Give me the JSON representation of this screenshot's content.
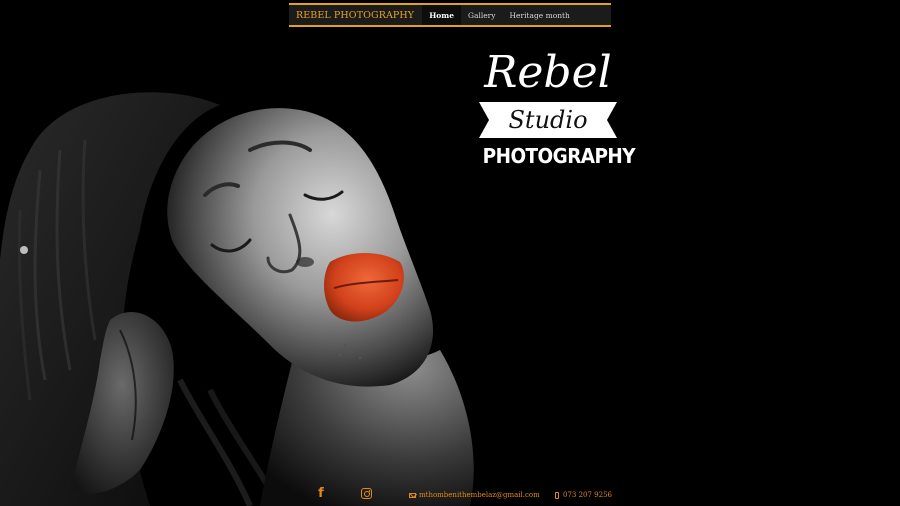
{
  "nav": {
    "brand": "REBEL PHOTOGRAPHY",
    "items": [
      {
        "label": "Home",
        "active": true
      },
      {
        "label": "Gallery",
        "active": false
      },
      {
        "label": "Heritage month",
        "active": false
      }
    ]
  },
  "logo": {
    "line1": "Rebel",
    "line2": "Studio",
    "line3": "PHOTOGRAPHY"
  },
  "footer": {
    "facebook_icon": "facebook-icon",
    "instagram_icon": "instagram-icon",
    "email_icon": "envelope-icon",
    "email": "mthombenithembelaz@gmail.com",
    "phone_icon": "mobile-phone-icon",
    "phone": "073 207 9256"
  },
  "colors": {
    "accent": "#e7a320",
    "footer_text": "#e08b18",
    "background": "#000000",
    "navbar_bg": "#1b1b1b",
    "lips": "#d9461e"
  }
}
